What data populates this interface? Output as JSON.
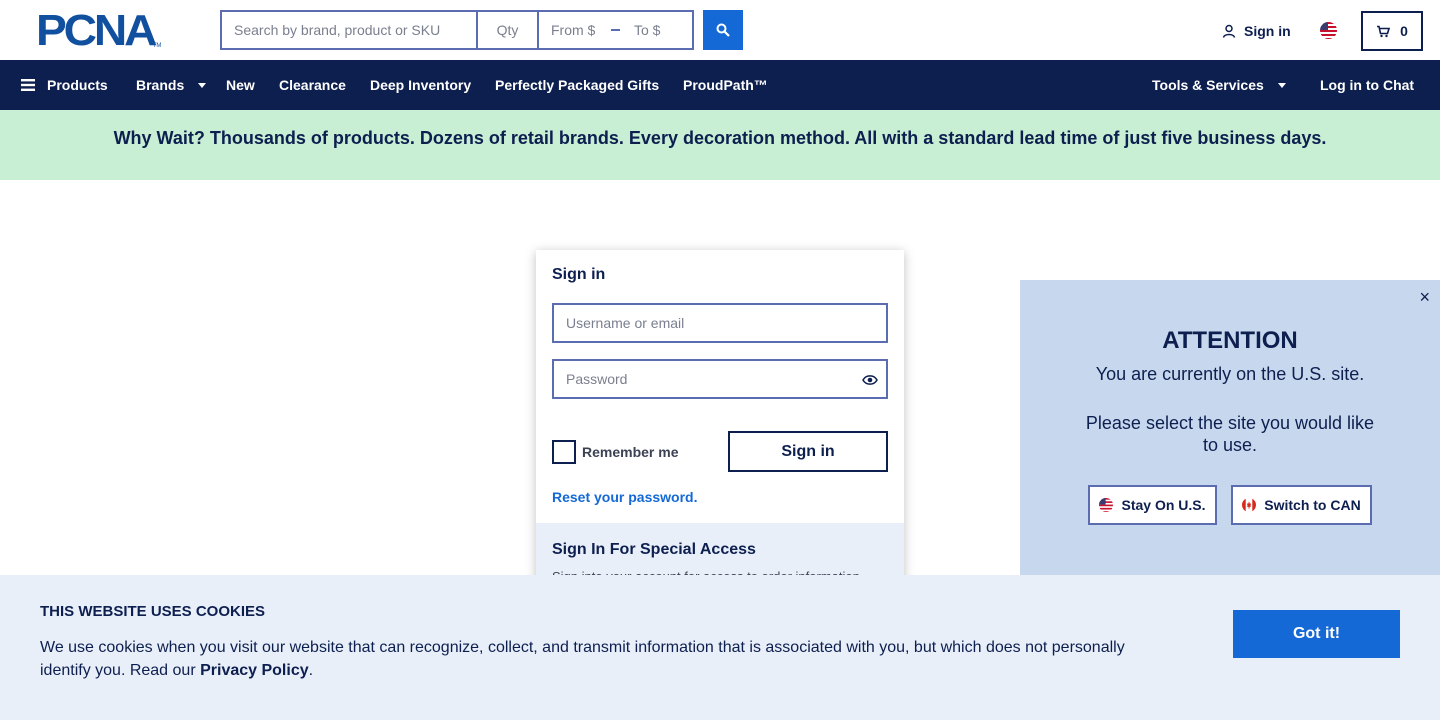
{
  "header": {
    "logo_text": "PCNA",
    "logo_tm": "TM",
    "search_placeholder": "Search by brand, product or SKU",
    "qty_placeholder": "Qty",
    "price_from_placeholder": "From $",
    "price_to_placeholder": "To $",
    "signin_label": "Sign in",
    "cart_count": "0",
    "region_flag": "us-flag-icon"
  },
  "nav": {
    "products": "Products",
    "brands": "Brands",
    "new": "New",
    "clearance": "Clearance",
    "deep_inventory": "Deep Inventory",
    "gifts": "Perfectly Packaged Gifts",
    "proudpath": "ProudPath™",
    "tools": "Tools & Services",
    "chat": "Log in to Chat"
  },
  "promo": {
    "text": "Why Wait? Thousands of products. Dozens of retail brands. Every decoration method. All with a standard lead time of just five business days."
  },
  "signin_form": {
    "title": "Sign in",
    "username_placeholder": "Username or email",
    "password_placeholder": "Password",
    "remember_label": "Remember me",
    "submit_label": "Sign in",
    "reset_link": "Reset your password.",
    "special_title": "Sign In For Special Access",
    "special_text": "Sign into your account for access to order information"
  },
  "attention": {
    "title": "ATTENTION",
    "line1": "You are currently on the U.S. site.",
    "line2": "Please select the site you would like to use.",
    "stay_label": "Stay On U.S.",
    "switch_label": "Switch to CAN",
    "close_label": "×"
  },
  "cookie": {
    "title": "THIS WEBSITE USES COOKIES",
    "text": "We use cookies when you visit our website that can recognize, collect, and transmit information that is associated with you, but which does not personally identify you. Read our ",
    "link": "Privacy Policy",
    "period": ".",
    "button": "Got it!"
  },
  "colors": {
    "navy": "#0d1f4f",
    "accent_blue": "#1469d6",
    "promo_green": "#c8efd4",
    "panel_blue": "#c7d8ee",
    "light_blue": "#e9eff9"
  }
}
